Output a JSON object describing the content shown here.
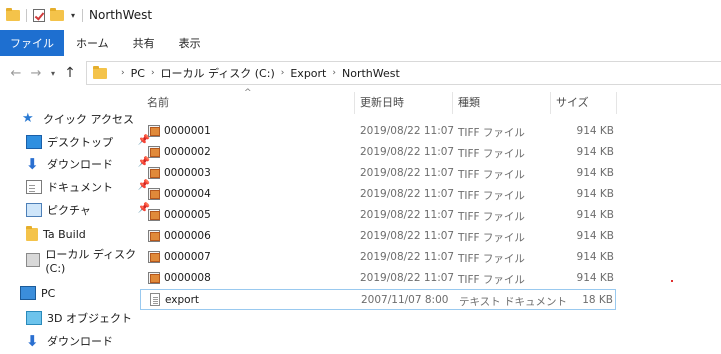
{
  "window": {
    "title": "NorthWest"
  },
  "ribbon": {
    "tabs": [
      "ファイル",
      "ホーム",
      "共有",
      "表示"
    ]
  },
  "address": {
    "crumbs": [
      "PC",
      "ローカル ディスク (C:)",
      "Export",
      "NorthWest"
    ]
  },
  "sidebar": {
    "items": [
      {
        "label": "クイック アクセス",
        "icon": "star-icon",
        "pinned": false
      },
      {
        "label": "デスクトップ",
        "icon": "desktop-icon",
        "pinned": true
      },
      {
        "label": "ダウンロード",
        "icon": "download-icon",
        "pinned": true
      },
      {
        "label": "ドキュメント",
        "icon": "document-icon",
        "pinned": true
      },
      {
        "label": "ピクチャ",
        "icon": "pictures-icon",
        "pinned": true
      },
      {
        "label": "Ta Build",
        "icon": "folder-icon",
        "pinned": false
      },
      {
        "label": "ローカル ディスク (C:)",
        "icon": "drive-icon",
        "pinned": false
      },
      {
        "label": "PC",
        "icon": "pc-icon",
        "pinned": false
      },
      {
        "label": "3D オブジェクト",
        "icon": "3d-objects-icon",
        "pinned": false
      },
      {
        "label": "ダウンロード",
        "icon": "download-icon",
        "pinned": false
      }
    ]
  },
  "columns": {
    "name": "名前",
    "date": "更新日時",
    "type": "種類",
    "size": "サイズ"
  },
  "files": [
    {
      "name": "0000001",
      "date": "2019/08/22 11:07",
      "type": "TIFF ファイル",
      "size": "914 KB",
      "icon": "tiff-icon"
    },
    {
      "name": "0000002",
      "date": "2019/08/22 11:07",
      "type": "TIFF ファイル",
      "size": "914 KB",
      "icon": "tiff-icon"
    },
    {
      "name": "0000003",
      "date": "2019/08/22 11:07",
      "type": "TIFF ファイル",
      "size": "914 KB",
      "icon": "tiff-icon"
    },
    {
      "name": "0000004",
      "date": "2019/08/22 11:07",
      "type": "TIFF ファイル",
      "size": "914 KB",
      "icon": "tiff-icon"
    },
    {
      "name": "0000005",
      "date": "2019/08/22 11:07",
      "type": "TIFF ファイル",
      "size": "914 KB",
      "icon": "tiff-icon"
    },
    {
      "name": "0000006",
      "date": "2019/08/22 11:07",
      "type": "TIFF ファイル",
      "size": "914 KB",
      "icon": "tiff-icon"
    },
    {
      "name": "0000007",
      "date": "2019/08/22 11:07",
      "type": "TIFF ファイル",
      "size": "914 KB",
      "icon": "tiff-icon"
    },
    {
      "name": "0000008",
      "date": "2019/08/22 11:07",
      "type": "TIFF ファイル",
      "size": "914 KB",
      "icon": "tiff-icon"
    },
    {
      "name": "export",
      "date": "2007/11/07 8:00",
      "type": "テキスト ドキュメント",
      "size": "18 KB",
      "icon": "text-file-icon",
      "selected": true
    }
  ],
  "colors": {
    "file_tab": "#1e6fd0",
    "selection_border": "#99c9ef"
  }
}
